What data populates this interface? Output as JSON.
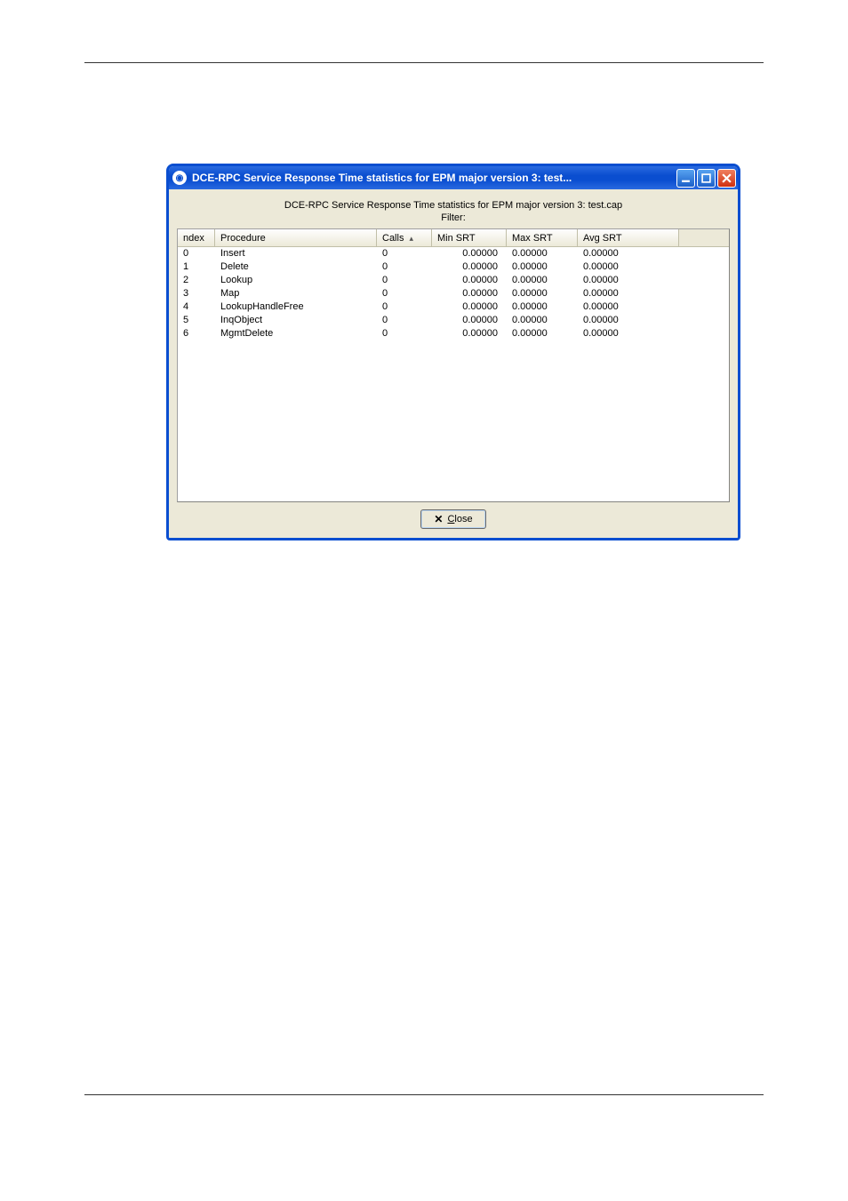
{
  "window": {
    "title": "DCE-RPC Service Response Time statistics for EPM major version 3: test...",
    "subtitle": "DCE-RPC Service Response Time statistics for EPM major version 3: test.cap",
    "filter_label": "Filter:",
    "close_label": "Close"
  },
  "columns": {
    "index": "ndex",
    "procedure": "Procedure",
    "calls": "Calls",
    "min_srt": "Min SRT",
    "max_srt": "Max SRT",
    "avg_srt": "Avg SRT"
  },
  "rows": [
    {
      "index": "0",
      "procedure": "Insert",
      "calls": "0",
      "min": "0.00000",
      "max": "0.00000",
      "avg": "0.00000"
    },
    {
      "index": "1",
      "procedure": "Delete",
      "calls": "0",
      "min": "0.00000",
      "max": "0.00000",
      "avg": "0.00000"
    },
    {
      "index": "2",
      "procedure": "Lookup",
      "calls": "0",
      "min": "0.00000",
      "max": "0.00000",
      "avg": "0.00000"
    },
    {
      "index": "3",
      "procedure": "Map",
      "calls": "0",
      "min": "0.00000",
      "max": "0.00000",
      "avg": "0.00000"
    },
    {
      "index": "4",
      "procedure": "LookupHandleFree",
      "calls": "0",
      "min": "0.00000",
      "max": "0.00000",
      "avg": "0.00000"
    },
    {
      "index": "5",
      "procedure": "InqObject",
      "calls": "0",
      "min": "0.00000",
      "max": "0.00000",
      "avg": "0.00000"
    },
    {
      "index": "6",
      "procedure": "MgmtDelete",
      "calls": "0",
      "min": "0.00000",
      "max": "0.00000",
      "avg": "0.00000"
    }
  ]
}
